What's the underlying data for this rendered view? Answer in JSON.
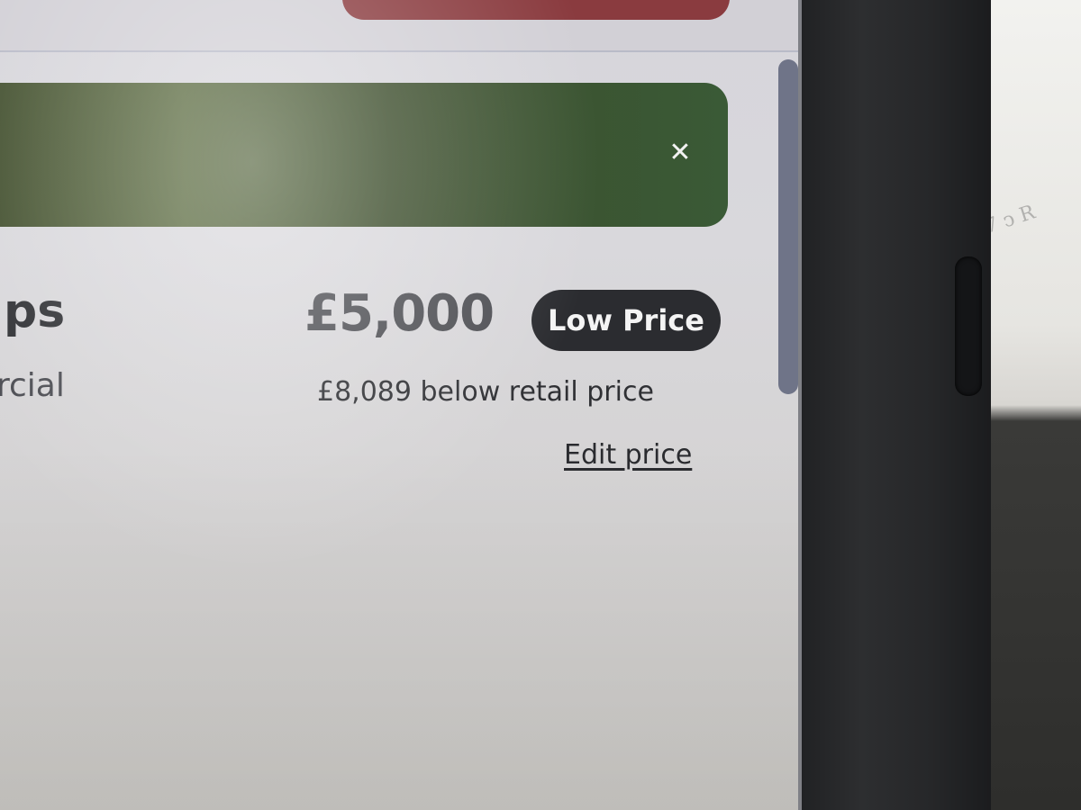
{
  "listing": {
    "title_fragment": "ps",
    "subtitle_fragment": "rcial"
  },
  "pricing": {
    "price": "£5,000",
    "badge": "Low Price",
    "retail_comparison": "£8,089 below retail price",
    "edit_label": "Edit price"
  },
  "banner": {
    "close_symbol": "✕",
    "close_icon": "close-icon"
  },
  "colors": {
    "banner": "#3c4d2c",
    "badge": "#2b2c30",
    "top_button": "#8a3b3f"
  }
}
